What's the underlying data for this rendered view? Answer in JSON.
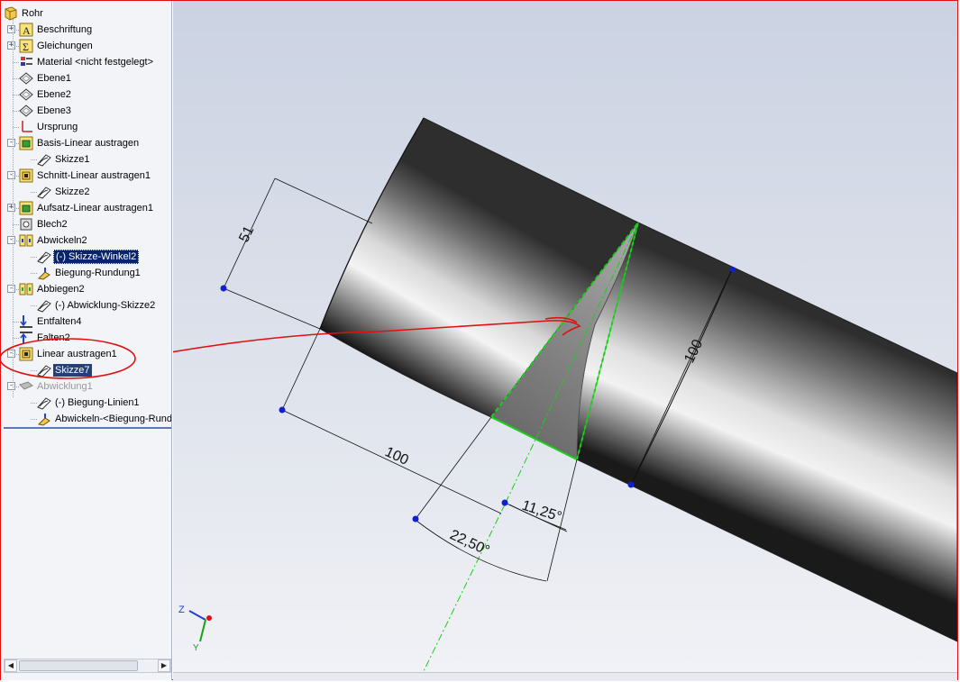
{
  "tree": {
    "items": [
      {
        "label": "Rohr",
        "icon": "part-icon",
        "expander": "",
        "level": 0,
        "state": "normal"
      },
      {
        "label": "Beschriftung",
        "icon": "annotation-icon",
        "expander": "+",
        "level": 1,
        "state": "normal"
      },
      {
        "label": "Gleichungen",
        "icon": "equations-icon",
        "expander": "+",
        "level": 1,
        "state": "normal"
      },
      {
        "label": "Material <nicht festgelegt>",
        "icon": "material-icon",
        "expander": "",
        "level": 1,
        "state": "normal"
      },
      {
        "label": "Ebene1",
        "icon": "plane-icon",
        "expander": "",
        "level": 1,
        "state": "normal"
      },
      {
        "label": "Ebene2",
        "icon": "plane-icon",
        "expander": "",
        "level": 1,
        "state": "normal"
      },
      {
        "label": "Ebene3",
        "icon": "plane-icon",
        "expander": "",
        "level": 1,
        "state": "normal"
      },
      {
        "label": "Ursprung",
        "icon": "origin-icon",
        "expander": "",
        "level": 1,
        "state": "normal"
      },
      {
        "label": "Basis-Linear austragen",
        "icon": "base-extrude-icon",
        "expander": "-",
        "level": 1,
        "state": "normal"
      },
      {
        "label": "Skizze1",
        "icon": "sketch-icon",
        "expander": "",
        "level": 2,
        "state": "normal"
      },
      {
        "label": "Schnitt-Linear austragen1",
        "icon": "cut-extrude-icon",
        "expander": "-",
        "level": 1,
        "state": "normal"
      },
      {
        "label": "Skizze2",
        "icon": "sketch-icon",
        "expander": "",
        "level": 2,
        "state": "normal"
      },
      {
        "label": "Aufsatz-Linear austragen1",
        "icon": "boss-extrude-icon",
        "expander": "+",
        "level": 1,
        "state": "normal"
      },
      {
        "label": "Blech2",
        "icon": "sheet-metal-icon",
        "expander": "",
        "level": 1,
        "state": "normal"
      },
      {
        "label": "Abwickeln2",
        "icon": "unfold-icon",
        "expander": "-",
        "level": 1,
        "state": "normal"
      },
      {
        "label": "(-) Skizze-Winkel2",
        "icon": "sketch-icon",
        "expander": "",
        "level": 2,
        "state": "selected"
      },
      {
        "label": "Biegung-Rundung1",
        "icon": "bend-icon",
        "expander": "",
        "level": 2,
        "state": "normal"
      },
      {
        "label": "Abbiegen2",
        "icon": "fold-icon",
        "expander": "-",
        "level": 1,
        "state": "normal"
      },
      {
        "label": "(-) Abwicklung-Skizze2",
        "icon": "sketch-icon",
        "expander": "",
        "level": 2,
        "state": "normal"
      },
      {
        "label": "Entfalten4",
        "icon": "unfold-arrow-icon",
        "expander": "",
        "level": 1,
        "state": "normal"
      },
      {
        "label": "Falten2",
        "icon": "fold-arrow-icon",
        "expander": "",
        "level": 1,
        "state": "normal"
      },
      {
        "label": "Linear austragen1",
        "icon": "cut-extrude-icon",
        "expander": "-",
        "level": 1,
        "state": "normal"
      },
      {
        "label": "Skizze7",
        "icon": "sketch-icon",
        "expander": "",
        "level": 2,
        "state": "selected-dark"
      },
      {
        "label": "Abwicklung1",
        "icon": "flat-pattern-icon",
        "expander": "-",
        "level": 1,
        "state": "grey"
      },
      {
        "label": "(-) Biegung-Linien1",
        "icon": "sketch-icon",
        "expander": "",
        "level": 2,
        "state": "normal"
      },
      {
        "label": "Abwickeln-<Biegung-Rundu",
        "icon": "bend-icon",
        "expander": "",
        "level": 2,
        "state": "normal"
      }
    ]
  },
  "viewport": {
    "dimensions": {
      "d51": "51",
      "d100_left": "100",
      "d100_right": "100",
      "angle_small": "11,25°",
      "angle_large": "22,50°"
    },
    "triad": {
      "z": "Z",
      "y": "Y"
    }
  },
  "colors": {
    "frame": "#e01010",
    "annotation": "#e01010",
    "sketch": "#18d018",
    "handle": "#1020d0",
    "selection": "#0a246a"
  }
}
